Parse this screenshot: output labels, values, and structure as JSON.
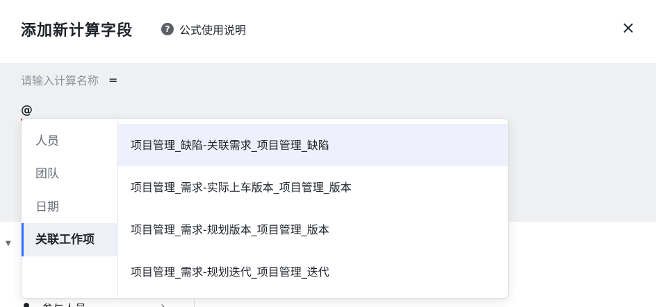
{
  "dialog": {
    "title": "添加新计算字段",
    "help_icon": "?",
    "help_text": "公式使用说明",
    "close_icon": "×"
  },
  "editor": {
    "name_placeholder": "请输入计算名称",
    "equals": "=",
    "formula_text": "@"
  },
  "dropdown": {
    "categories": [
      "人员",
      "团队",
      "日期",
      "关联工作项"
    ],
    "selected_category": "关联工作项",
    "options": [
      "项目管理_缺陷-关联需求_项目管理_缺陷",
      "项目管理_需求-实际上车版本_项目管理_版本",
      "项目管理_需求-规划版本_项目管理_版本",
      "项目管理_需求-规划迭代_项目管理_迭代"
    ]
  },
  "background": {
    "collapse_arrow": "▼",
    "partial_item_label": "参与人员",
    "partial_item_chevron": "›"
  }
}
